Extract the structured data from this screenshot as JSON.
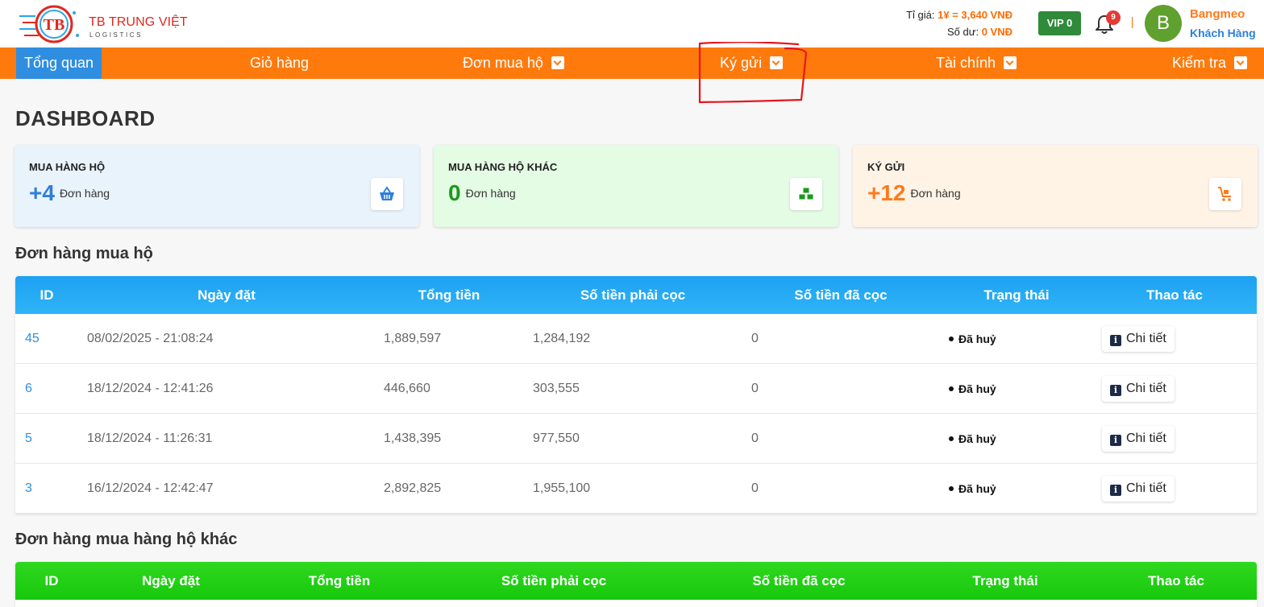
{
  "header": {
    "brand_name": "TB TRUNG VIỆT",
    "brand_sub": "LOGISTICS",
    "logo_letters": "TB",
    "rate_label": "Tỉ giá:",
    "rate_value": "1¥ = 3,640 VNĐ",
    "balance_label": "Số dư:",
    "balance_value": "0 VNĐ",
    "vip_label": "VIP 0",
    "notification_count": "9",
    "avatar_letter": "B",
    "user_name": "Bangmeo",
    "user_role": "Khách Hàng"
  },
  "nav": {
    "items": [
      {
        "label": "Tổng quan"
      },
      {
        "label": "Giỏ hàng"
      },
      {
        "label": "Đơn mua hộ"
      },
      {
        "label": "Ký gửi"
      },
      {
        "label": "Tài chính"
      },
      {
        "label": "Kiểm tra"
      }
    ]
  },
  "page_title": "DASHBOARD",
  "cards": [
    {
      "label": "MUA HÀNG HỘ",
      "value": "+4",
      "unit": "Đơn hàng",
      "color": "#2f7fd8",
      "bg": "#e9f3fc",
      "icon": "basket-icon"
    },
    {
      "label": "MUA HÀNG HỘ KHÁC",
      "value": "0",
      "unit": "Đơn hàng",
      "color": "#1a9a1a",
      "bg": "#e4fbe4",
      "icon": "cubes-icon"
    },
    {
      "label": "KÝ GỬI",
      "value": "+12",
      "unit": "Đơn hàng",
      "color": "#ff7a1a",
      "bg": "#fff3e6",
      "icon": "cart-icon"
    }
  ],
  "orders_section": {
    "title": "Đơn hàng mua hộ",
    "headers": [
      "ID",
      "Ngày đặt",
      "Tổng tiền",
      "Số tiền phải cọc",
      "Số tiền đã cọc",
      "Trạng thái",
      "Thao tác"
    ],
    "rows": [
      {
        "id": "45",
        "date": "08/02/2025 - 21:08:24",
        "total": "1,889,597",
        "deposit_required": "1,284,192",
        "deposit_paid": "0",
        "status": "Đã huỷ",
        "action": "Chi tiết"
      },
      {
        "id": "6",
        "date": "18/12/2024 - 12:41:26",
        "total": "446,660",
        "deposit_required": "303,555",
        "deposit_paid": "0",
        "status": "Đã huỷ",
        "action": "Chi tiết"
      },
      {
        "id": "5",
        "date": "18/12/2024 - 11:26:31",
        "total": "1,438,395",
        "deposit_required": "977,550",
        "deposit_paid": "0",
        "status": "Đã huỷ",
        "action": "Chi tiết"
      },
      {
        "id": "3",
        "date": "16/12/2024 - 12:42:47",
        "total": "2,892,825",
        "deposit_required": "1,955,100",
        "deposit_paid": "0",
        "status": "Đã huỷ",
        "action": "Chi tiết"
      }
    ]
  },
  "other_orders_section": {
    "title": "Đơn hàng mua hàng hộ khác",
    "headers": [
      "ID",
      "Ngày đặt",
      "Tổng tiền",
      "Số tiền phải cọc",
      "Số tiền đã cọc",
      "Trạng thái",
      "Thao tác"
    ]
  },
  "colors": {
    "nav": "#ff7a0c",
    "nav_active": "#2f8ee0",
    "annotation": "#e8141c"
  }
}
